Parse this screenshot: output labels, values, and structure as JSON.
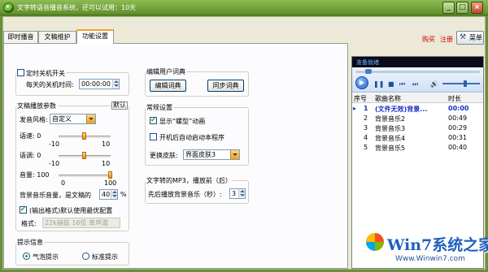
{
  "window": {
    "title": "文字转语音播音系统，还可以试用：10天",
    "buttons": [
      "_",
      "□",
      "×"
    ]
  },
  "header": {
    "buy": "购买",
    "register": "注册",
    "menu": "菜单"
  },
  "tabs": [
    {
      "label": "即时播音"
    },
    {
      "label": "文稿维护"
    },
    {
      "label": "功能设置"
    }
  ],
  "shutdown": {
    "label": "定时关机开关",
    "daily_time_label": "每天的关机时间:",
    "daily_time": "00:00:00"
  },
  "playback": {
    "legend": "文稿播放参数",
    "default_btn": "默认",
    "style_label": "发音风格:",
    "style_value": "自定义",
    "rate_label": "语速: 0",
    "rate_min": "-10",
    "rate_max": "10",
    "rate_value": 0,
    "pitch_label": "语调: 0",
    "pitch_min": "-10",
    "pitch_max": "10",
    "pitch_value": 0,
    "volume_label": "音量: 100",
    "volume_min": "0",
    "volume_max": "100",
    "volume_value": 100,
    "bgm_label": "背景音乐音量，是文稿的",
    "bgm_value": "40",
    "bgm_unit": "%",
    "format_check": "(输出格式)默认使用最优配置",
    "format_label": "格式:",
    "format_value": "22k赫兹 16位 单声道"
  },
  "hint": {
    "legend": "提示信息",
    "bubble": "气泡提示",
    "standard": "标准提示"
  },
  "dict": {
    "legend": "编辑用户词典",
    "edit_btn": "编辑词典",
    "sync_btn": "同步词典"
  },
  "general": {
    "legend": "常规设置",
    "show_anim": "显示“螺型”动画",
    "autostart": "开机后自动启动本程序",
    "skin_label": "更换皮肤:",
    "skin_value": "界面皮肤3"
  },
  "mp3": {
    "legend": "文字转的MP3，播放前（后）",
    "lead_label": "先后播放背景音乐（秒）:",
    "lead_value": "3"
  },
  "player": {
    "status": "准备就绪",
    "columns": {
      "index": "序号",
      "name": "歌曲名称",
      "duration": "时长"
    },
    "rows": [
      {
        "index": "1",
        "name": "(文件无效)背景...",
        "duration": "00:00",
        "current": true
      },
      {
        "index": "2",
        "name": "背景音乐2",
        "duration": "00:49"
      },
      {
        "index": "3",
        "name": "背景音乐3",
        "duration": "00:29"
      },
      {
        "index": "4",
        "name": "背景音乐4",
        "duration": "00:31"
      },
      {
        "index": "5",
        "name": "背景音乐5",
        "duration": "00:40"
      }
    ]
  },
  "watermark": {
    "brand": "Win7系统之家",
    "url": "Www.Winwin7.com"
  }
}
